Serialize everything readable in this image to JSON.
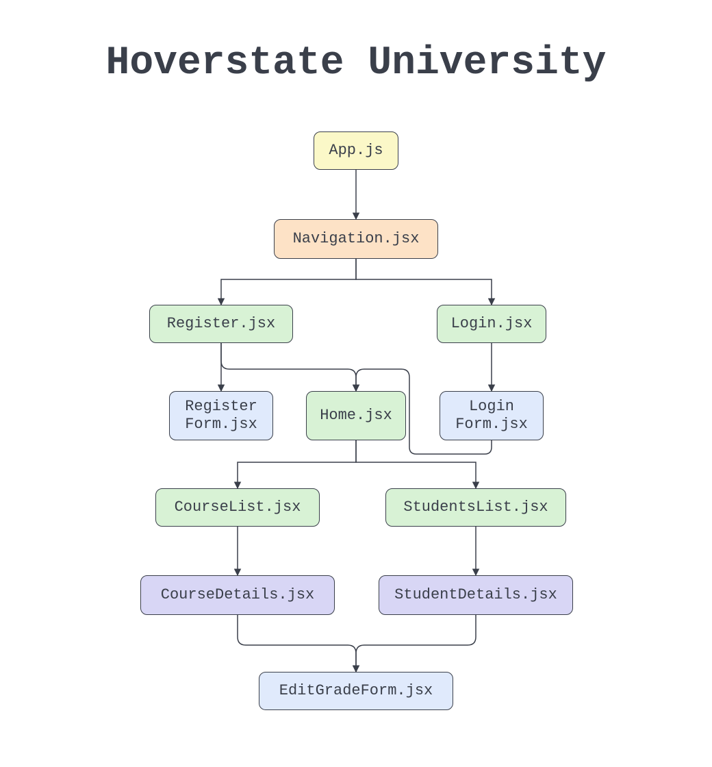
{
  "title": "Hoverstate University",
  "nodes": {
    "app": {
      "label": "App.js"
    },
    "navigation": {
      "label": "Navigation.jsx"
    },
    "register": {
      "label": "Register.jsx"
    },
    "login": {
      "label": "Login.jsx"
    },
    "registerForm": {
      "label": "Register\nForm.jsx"
    },
    "home": {
      "label": "Home.jsx"
    },
    "loginForm": {
      "label": "Login\nForm.jsx"
    },
    "courseList": {
      "label": "CourseList.jsx"
    },
    "studentsList": {
      "label": "StudentsList.jsx"
    },
    "courseDetails": {
      "label": "CourseDetails.jsx"
    },
    "studentDetails": {
      "label": "StudentDetails.jsx"
    },
    "editGradeForm": {
      "label": "EditGradeForm.jsx"
    }
  },
  "edges": [
    {
      "from": "app",
      "to": "navigation"
    },
    {
      "from": "navigation",
      "to": "register"
    },
    {
      "from": "navigation",
      "to": "login"
    },
    {
      "from": "register",
      "to": "registerForm"
    },
    {
      "from": "register",
      "to": "home"
    },
    {
      "from": "login",
      "to": "loginForm"
    },
    {
      "from": "loginForm",
      "to": "home"
    },
    {
      "from": "home",
      "to": "courseList"
    },
    {
      "from": "home",
      "to": "studentsList"
    },
    {
      "from": "courseList",
      "to": "courseDetails"
    },
    {
      "from": "studentsList",
      "to": "studentDetails"
    },
    {
      "from": "courseDetails",
      "to": "editGradeForm"
    },
    {
      "from": "studentDetails",
      "to": "editGradeForm"
    }
  ],
  "colors": {
    "yellow": "#fbf8c8",
    "peach": "#fde2c6",
    "green": "#d8f2d5",
    "blue": "#e0eafc",
    "purple": "#d8d6f5",
    "stroke": "#3a3f4a"
  }
}
